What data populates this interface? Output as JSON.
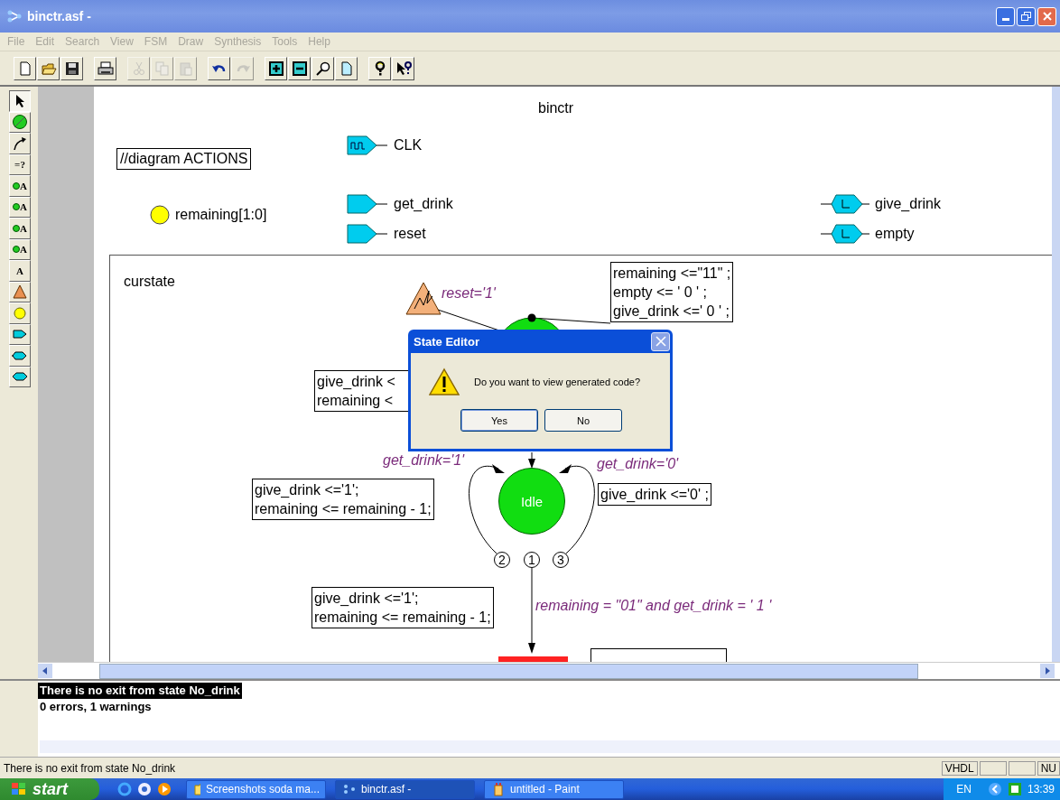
{
  "window": {
    "title": "binctr.asf -"
  },
  "menu": [
    {
      "label": "File",
      "disabled": true
    },
    {
      "label": "Edit",
      "disabled": true
    },
    {
      "label": "Search",
      "disabled": true
    },
    {
      "label": "View",
      "disabled": true
    },
    {
      "label": "FSM",
      "disabled": true
    },
    {
      "label": "Draw",
      "disabled": true
    },
    {
      "label": "Synthesis",
      "disabled": true
    },
    {
      "label": "Tools",
      "disabled": true
    },
    {
      "label": "Help",
      "disabled": true
    }
  ],
  "toolbar": [
    [
      {
        "kind": "new",
        "disabled": false
      },
      {
        "kind": "open",
        "disabled": false
      },
      {
        "kind": "save",
        "disabled": false
      }
    ],
    [
      {
        "kind": "print",
        "disabled": false
      }
    ],
    [
      {
        "kind": "cut",
        "disabled": true
      },
      {
        "kind": "copy",
        "disabled": true
      },
      {
        "kind": "paste",
        "disabled": true
      }
    ],
    [
      {
        "kind": "undo",
        "disabled": false
      },
      {
        "kind": "redo",
        "disabled": true
      }
    ],
    [
      {
        "kind": "zoom-in",
        "disabled": false
      },
      {
        "kind": "zoom-out",
        "disabled": false
      },
      {
        "kind": "zoom",
        "disabled": false
      },
      {
        "kind": "page",
        "disabled": false
      }
    ],
    [
      {
        "kind": "help",
        "disabled": false
      },
      {
        "kind": "context-help",
        "disabled": false
      }
    ]
  ],
  "tools": [
    {
      "kind": "pointer",
      "selected": true
    },
    {
      "kind": "state",
      "selected": false
    },
    {
      "kind": "transition",
      "selected": false
    },
    {
      "kind": "condition",
      "label": "=?",
      "selected": false
    },
    {
      "kind": "entry-action",
      "label": "A",
      "selected": false
    },
    {
      "kind": "state-action",
      "label": "A",
      "selected": false
    },
    {
      "kind": "exit-action",
      "label": "A",
      "selected": false
    },
    {
      "kind": "transition-action",
      "label": "A",
      "selected": false
    },
    {
      "kind": "text",
      "label": "A",
      "selected": false
    },
    {
      "kind": "reset",
      "selected": false
    },
    {
      "kind": "variable",
      "selected": false
    },
    {
      "kind": "input",
      "selected": false
    },
    {
      "kind": "output",
      "selected": false
    },
    {
      "kind": "inout",
      "selected": false
    }
  ],
  "diagram": {
    "title": "binctr",
    "actions_label": "//diagram ACTIONS",
    "signals": [
      {
        "kind": "variable",
        "name": "remaining[1:0]"
      },
      {
        "kind": "clock",
        "name": "CLK"
      },
      {
        "kind": "input",
        "name": "get_drink"
      },
      {
        "kind": "input",
        "name": "reset"
      },
      {
        "kind": "output",
        "name": "give_drink"
      },
      {
        "kind": "output",
        "name": "empty"
      }
    ],
    "machine": {
      "name": "curstate",
      "reset_condition": "reset='1'",
      "reset_actions": [
        "remaining <=\"11\" ;",
        "empty <= ' 0 ' ;",
        "give_drink <=' 0 ' ;"
      ],
      "hidden_actions": [
        "give_drink <",
        "remaining <"
      ],
      "state": "Idle",
      "transitions": [
        {
          "condition": "get_drink='1'",
          "actions": [
            "give_drink <='1';",
            "remaining <= remaining - 1;"
          ]
        },
        {
          "condition": "get_drink='0'",
          "actions": [
            "give_drink <='0' ;"
          ]
        },
        {
          "condition": "remaining = \"01\" and get_drink = ' 1 '",
          "actions": [
            "give_drink <='1';",
            "remaining <= remaining - 1;"
          ]
        }
      ],
      "priorities": [
        "2",
        "1",
        "3"
      ]
    }
  },
  "dialog": {
    "title": "State Editor",
    "message": "Do you want to view generated code?",
    "buttons": [
      {
        "label": "Yes",
        "selected": true
      },
      {
        "label": "No",
        "selected": false
      }
    ]
  },
  "output": [
    {
      "text": "There is no exit from state No_drink",
      "selected": true
    },
    {
      "text": "0 errors, 1 warnings",
      "selected": false
    }
  ],
  "status_bar": {
    "message": "There is no exit from state No_drink",
    "panes": [
      "VHDL",
      "NU"
    ]
  },
  "taskbar": {
    "start": "start",
    "tasks": [
      {
        "label": "Screenshots soda ma...",
        "kind": "folder",
        "selected": false
      },
      {
        "label": "binctr.asf -",
        "kind": "fsm",
        "selected": true
      },
      {
        "label": "untitled - Paint",
        "kind": "paint",
        "selected": false
      }
    ],
    "language": "EN",
    "clock": "13:39"
  }
}
